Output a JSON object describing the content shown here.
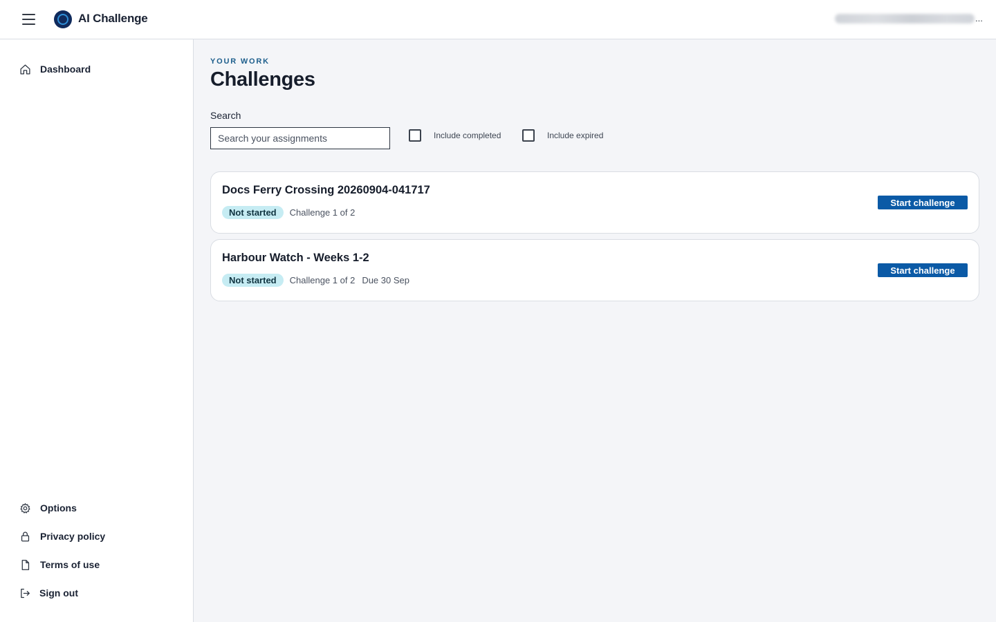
{
  "app": {
    "title": "AI Challenge",
    "user_menu_ellipsis": "..."
  },
  "sidebar": {
    "top_items": [
      {
        "label": "Dashboard",
        "icon": "home-icon"
      }
    ],
    "bottom_items": [
      {
        "label": "Options",
        "icon": "gear-icon"
      },
      {
        "label": "Privacy policy",
        "icon": "lock-icon"
      },
      {
        "label": "Terms of use",
        "icon": "document-icon"
      },
      {
        "label": "Sign out",
        "icon": "sign-out-icon"
      }
    ]
  },
  "main": {
    "eyebrow": "YOUR WORK",
    "title": "Challenges",
    "search": {
      "label": "Search",
      "placeholder": "Search your assignments",
      "value": ""
    },
    "filters": {
      "include_completed": {
        "label": "Include completed",
        "checked": false
      },
      "include_expired": {
        "label": "Include expired",
        "checked": false
      }
    },
    "assignments": [
      {
        "title": "Docs Ferry Crossing 20260904-041717",
        "status": "Not started",
        "progress": "Challenge 1 of 2",
        "due": "",
        "action": "Start challenge"
      },
      {
        "title": "Harbour Watch - Weeks 1-2",
        "status": "Not started",
        "progress": "Challenge 1 of 2",
        "due": "Due 30 Sep",
        "action": "Start challenge"
      }
    ]
  },
  "colors": {
    "accent": "#0b5aa6",
    "eyebrow": "#1d5e8c",
    "badge_bg": "#c6ecf3",
    "main_bg": "#f4f5f8"
  }
}
